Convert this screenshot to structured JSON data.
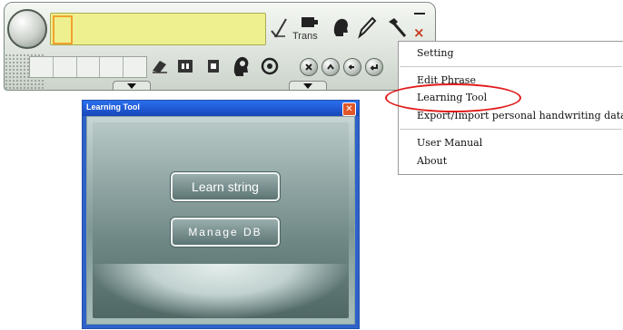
{
  "toolbar": {
    "trans_label": "Trans",
    "close_symbol": "×",
    "icons": [
      "pen-check-icon",
      "keyboard-icon",
      "head-icon",
      "pen-icon",
      "tools-icon"
    ],
    "row_icons": [
      "eraser-icon",
      "fullwidth-icon",
      "halfwidth-icon",
      "voice-head-icon",
      "at-icon"
    ],
    "round_buttons": [
      "cancel-icon",
      "up-icon",
      "left-icon",
      "enter-icon"
    ]
  },
  "menu": {
    "items": [
      "Setting",
      "Edit Phrase",
      "Learning Tool",
      "Export/Import personal handwriting data",
      "User Manual",
      "About"
    ],
    "highlighted": "Learning Tool",
    "highlight_color": "#e11b1b"
  },
  "learning_tool": {
    "title": "Learning Tool",
    "learn_button": "Learn string",
    "manage_button": "Manage DB"
  }
}
